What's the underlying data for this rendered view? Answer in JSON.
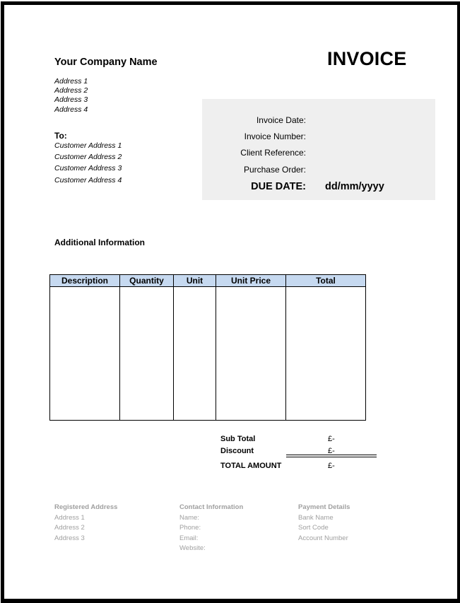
{
  "header": {
    "company_name": "Your Company Name",
    "company_address": [
      "Address 1",
      "Address 2",
      "Address 3",
      "Address 4"
    ],
    "title": "INVOICE"
  },
  "recipient": {
    "label": "To:",
    "address": [
      "Customer Address 1",
      "Customer Address 2",
      "Customer Address 3",
      "Customer Address 4"
    ]
  },
  "details": {
    "invoice_date_label": "Invoice Date:",
    "invoice_date_value": "",
    "invoice_number_label": "Invoice Number:",
    "invoice_number_value": "",
    "client_reference_label": "Client Reference:",
    "client_reference_value": "",
    "purchase_order_label": "Purchase Order:",
    "purchase_order_value": "",
    "due_date_label": "DUE DATE:",
    "due_date_value": "dd/mm/yyyy"
  },
  "additional_information": {
    "label": "Additional Information"
  },
  "items_table": {
    "columns": [
      "Description",
      "Quantity",
      "Unit",
      "Unit Price",
      "Total"
    ],
    "rows": []
  },
  "totals": {
    "subtotal_label": "Sub Total",
    "subtotal_value": "£-",
    "discount_label": "Discount",
    "discount_value": "£-",
    "total_label": "TOTAL AMOUNT",
    "total_value": "£-"
  },
  "footer": {
    "registered": {
      "heading": "Registered Address",
      "lines": [
        "Address 1",
        "Address 2",
        "Address 3"
      ]
    },
    "contact": {
      "heading": "Contact Information",
      "lines": [
        "Name:",
        "Phone:",
        "Email:",
        "Website:"
      ]
    },
    "payment": {
      "heading": "Payment Details",
      "lines": [
        "Bank Name",
        "Sort Code",
        "Account Number"
      ]
    }
  },
  "colors": {
    "table_header_fill": "#c6d9f0",
    "details_panel_fill": "#efefef",
    "footer_text": "#a0a0a0"
  }
}
